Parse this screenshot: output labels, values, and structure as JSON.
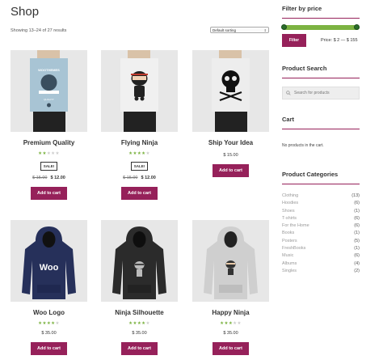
{
  "page": {
    "title": "Shop",
    "result_count": "Showing 13–24 of 27 results",
    "orderby_selected": "Default sorting"
  },
  "products": [
    {
      "title": "Premium Quality",
      "rating": 2,
      "sale_badge": "SALE!",
      "old_price": "$ 15.00",
      "price": "$ 12.00",
      "button": "Add to cart",
      "image": "poster-woo"
    },
    {
      "title": "Flying Ninja",
      "rating": 4,
      "sale_badge": "SALE!",
      "old_price": "$ 15.00",
      "price": "$ 12.00",
      "button": "Add to cart",
      "image": "poster-ninja"
    },
    {
      "title": "Ship Your Idea",
      "rating": null,
      "sale_badge": null,
      "old_price": null,
      "price": "$ 15.00",
      "button": "Add to cart",
      "image": "poster-skull"
    },
    {
      "title": "Woo Logo",
      "rating": 4,
      "sale_badge": null,
      "old_price": null,
      "price": "$ 35.00",
      "button": "Add to cart",
      "image": "hoodie-navy-woo"
    },
    {
      "title": "Ninja Silhouette",
      "rating": 4,
      "sale_badge": null,
      "old_price": null,
      "price": "$ 35.00",
      "button": "Add to cart",
      "image": "hoodie-black-ninja"
    },
    {
      "title": "Happy Ninja",
      "rating": 3,
      "sale_badge": null,
      "old_price": null,
      "price": "$ 35.00",
      "button": "Add to cart",
      "image": "hoodie-grey-ninja"
    }
  ],
  "sidebar": {
    "filter_title": "Filter by price",
    "filter_button": "Filter",
    "price_label": "Price: $ 2 — $ 155",
    "search_title": "Product Search",
    "search_placeholder": "Search for products",
    "cart_title": "Cart",
    "cart_empty": "No products in the cart.",
    "categories_title": "Product Categories",
    "categories": [
      {
        "name": "Clothing",
        "count": "(13)"
      },
      {
        "name": "Hoodies",
        "count": "(6)"
      },
      {
        "name": "Shoes",
        "count": "(1)"
      },
      {
        "name": "T-shirts",
        "count": "(6)"
      },
      {
        "name": "For the Home",
        "count": "(6)"
      },
      {
        "name": "Books",
        "count": "(1)"
      },
      {
        "name": "Posters",
        "count": "(5)"
      },
      {
        "name": "FreshBooks",
        "count": "(1)"
      },
      {
        "name": "Music",
        "count": "(6)"
      },
      {
        "name": "Albums",
        "count": "(4)"
      },
      {
        "name": "Singles",
        "count": "(2)"
      }
    ]
  },
  "colors": {
    "accent": "#96215a",
    "star": "#7cb342",
    "slider": "#7cb342"
  }
}
